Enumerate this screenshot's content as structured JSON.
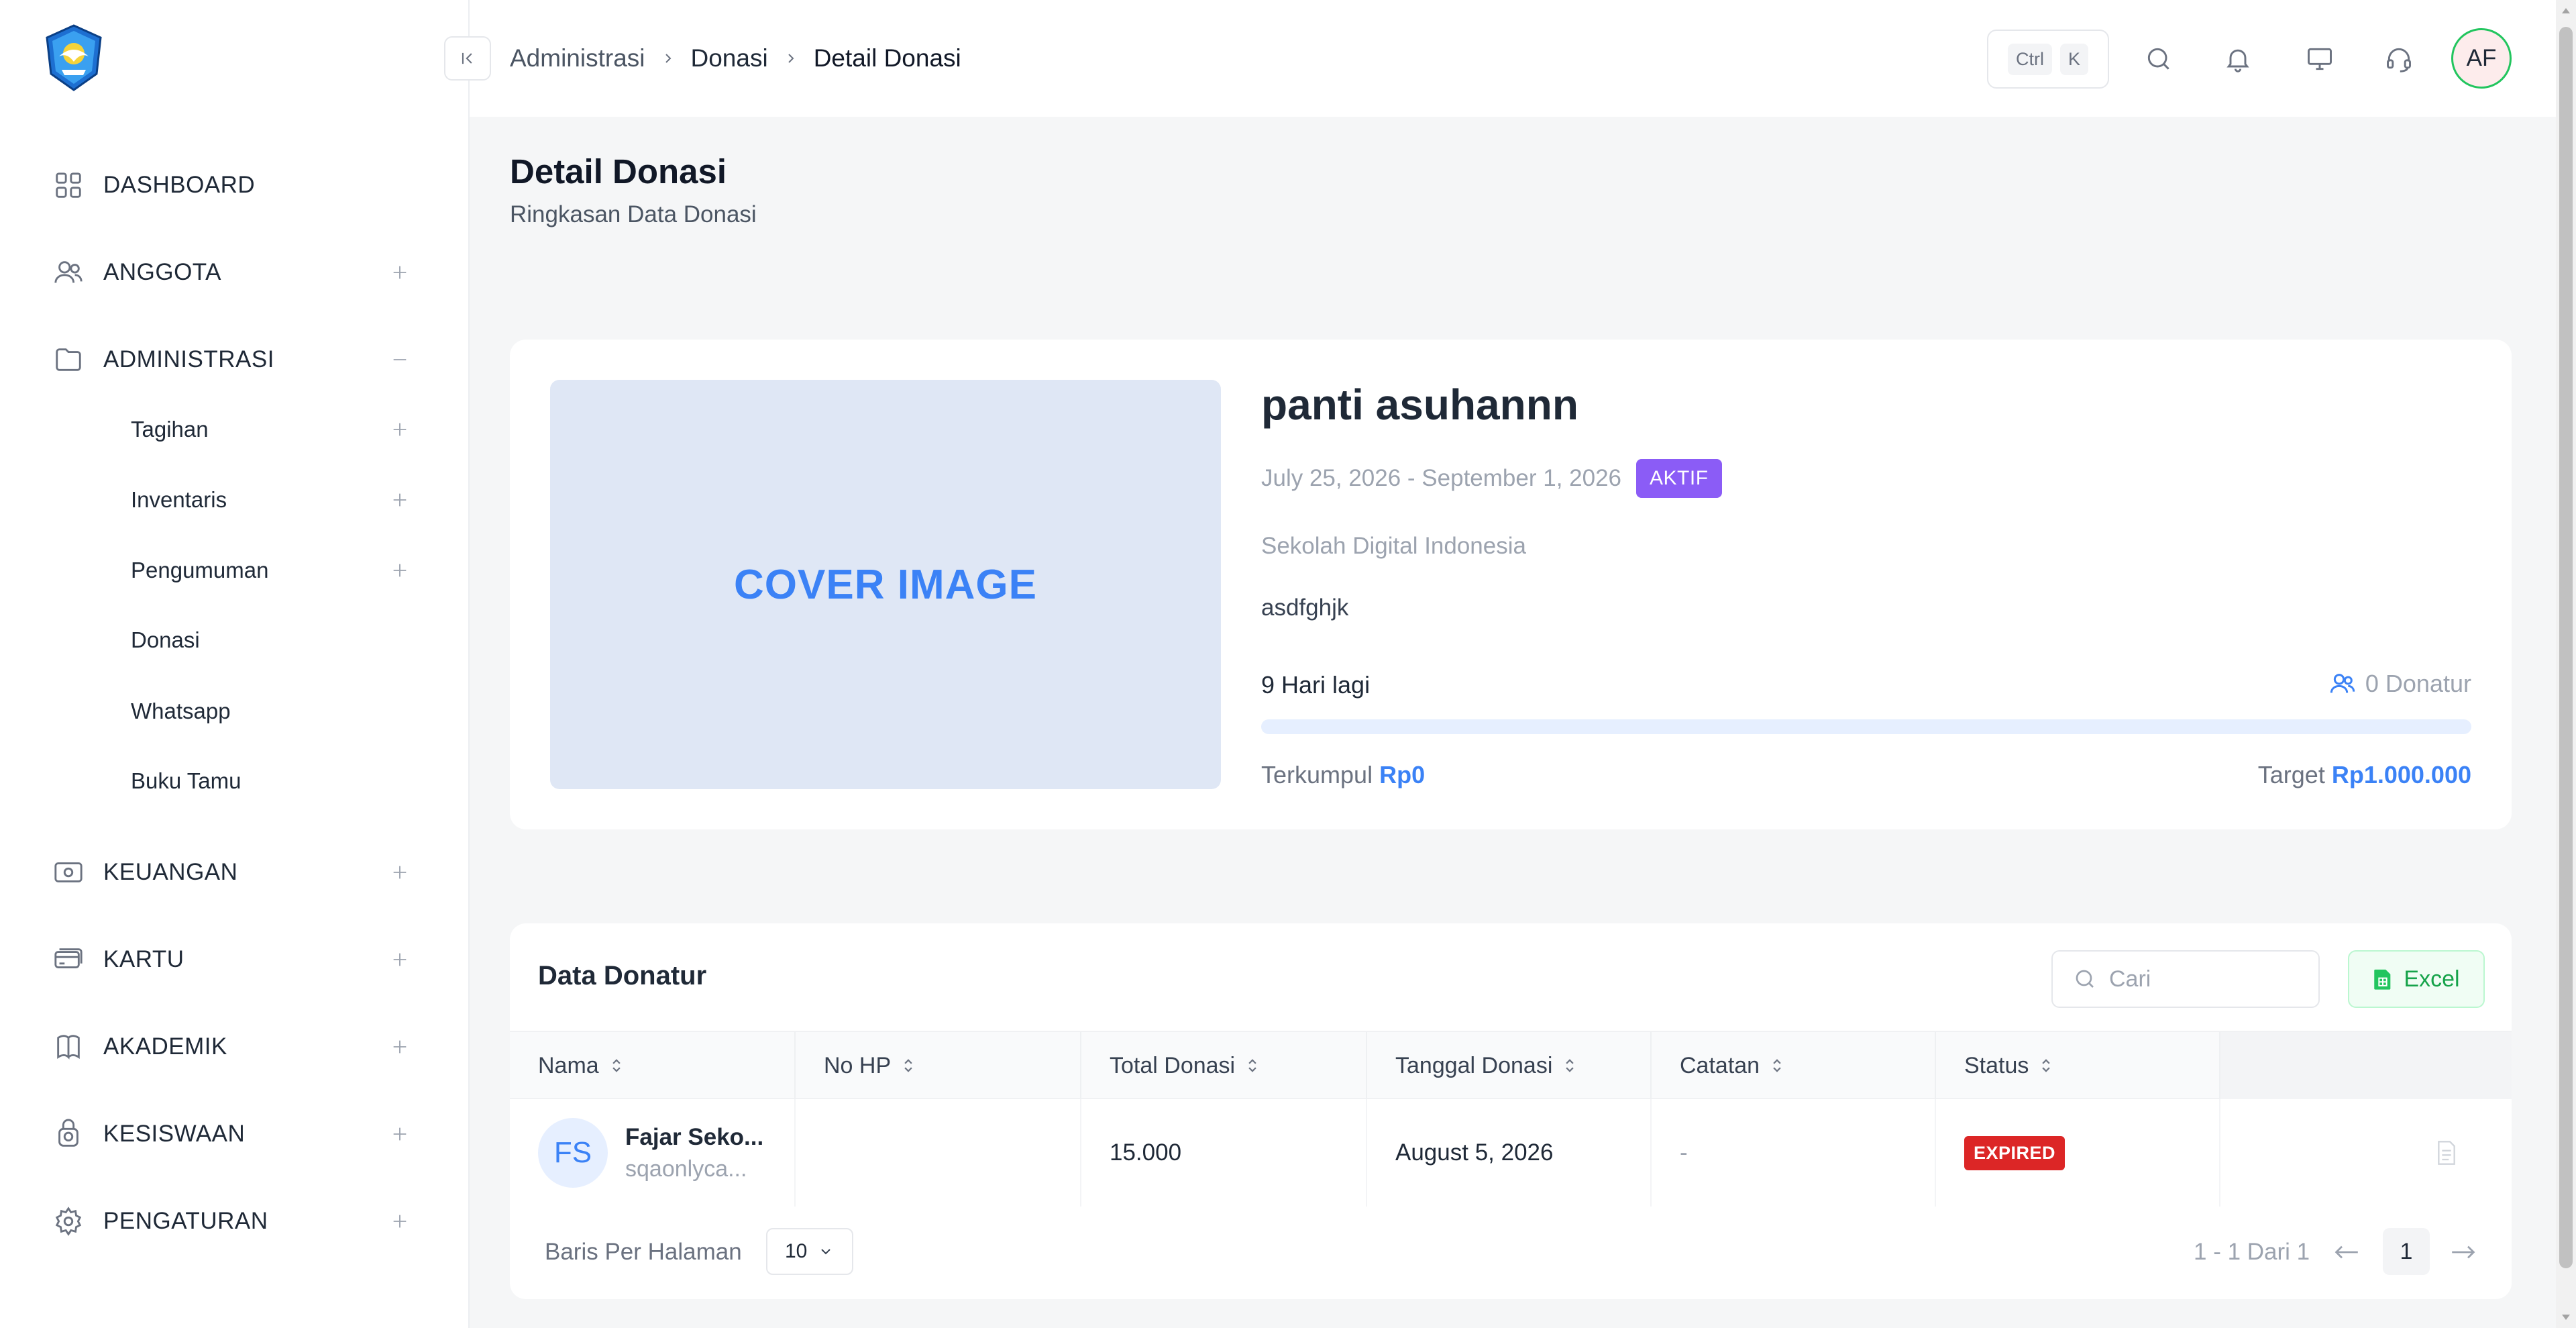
{
  "sidebar": {
    "items": [
      {
        "label": "DASHBOARD",
        "icon": "grid-icon"
      },
      {
        "label": "ANGGOTA",
        "icon": "users-icon"
      },
      {
        "label": "ADMINISTRASI",
        "icon": "folder-icon"
      },
      {
        "label": "KEUANGAN",
        "icon": "money-icon"
      },
      {
        "label": "KARTU",
        "icon": "card-icon"
      },
      {
        "label": "AKADEMIK",
        "icon": "book-icon"
      },
      {
        "label": "KESISWAAN",
        "icon": "student-icon"
      },
      {
        "label": "PENGATURAN",
        "icon": "gear-icon"
      }
    ],
    "sub_items": [
      {
        "label": "Tagihan"
      },
      {
        "label": "Inventaris"
      },
      {
        "label": "Pengumuman"
      },
      {
        "label": "Donasi"
      },
      {
        "label": "Whatsapp"
      },
      {
        "label": "Buku Tamu"
      }
    ]
  },
  "header": {
    "breadcrumb": [
      "Administrasi",
      "Donasi",
      "Detail Donasi"
    ],
    "shortcut": [
      "Ctrl",
      "K"
    ],
    "avatar_initials": "AF"
  },
  "page": {
    "title": "Detail Donasi",
    "subtitle": "Ringkasan Data Donasi"
  },
  "donasi": {
    "cover_text": "COVER IMAGE",
    "title": "panti asuhannn",
    "dates": "July 25, 2026 - September 1, 2026",
    "status": "AKTIF",
    "school": "Sekolah Digital Indonesia",
    "description": "asdfghjk",
    "days_left": "9 Hari lagi",
    "donatur_count": "0 Donatur",
    "collected_label": "Terkumpul",
    "collected_value": "Rp0",
    "target_label": "Target",
    "target_value": "Rp1.000.000",
    "progress_fraction": 0
  },
  "table": {
    "title": "Data Donatur",
    "search_placeholder": "Cari",
    "excel_label": "Excel",
    "columns": [
      "Nama",
      "No HP",
      "Total Donasi",
      "Tanggal Donasi",
      "Catatan",
      "Status"
    ],
    "rows": [
      {
        "initials": "FS",
        "name": "Fajar Seko...",
        "sub": "sqaonlyca...",
        "no_hp": "",
        "total": "15.000",
        "tanggal": "August 5, 2026",
        "catatan": "-",
        "status": "EXPIRED"
      }
    ],
    "rows_per_page_label": "Baris Per Halaman",
    "rows_per_page": "10",
    "page_info": "1 - 1 Dari 1",
    "current_page": "1"
  },
  "colors": {
    "accent": "#3b82f6",
    "aktif": "#8b5cf6",
    "expired": "#dc2626",
    "excel": "#16a34a"
  }
}
